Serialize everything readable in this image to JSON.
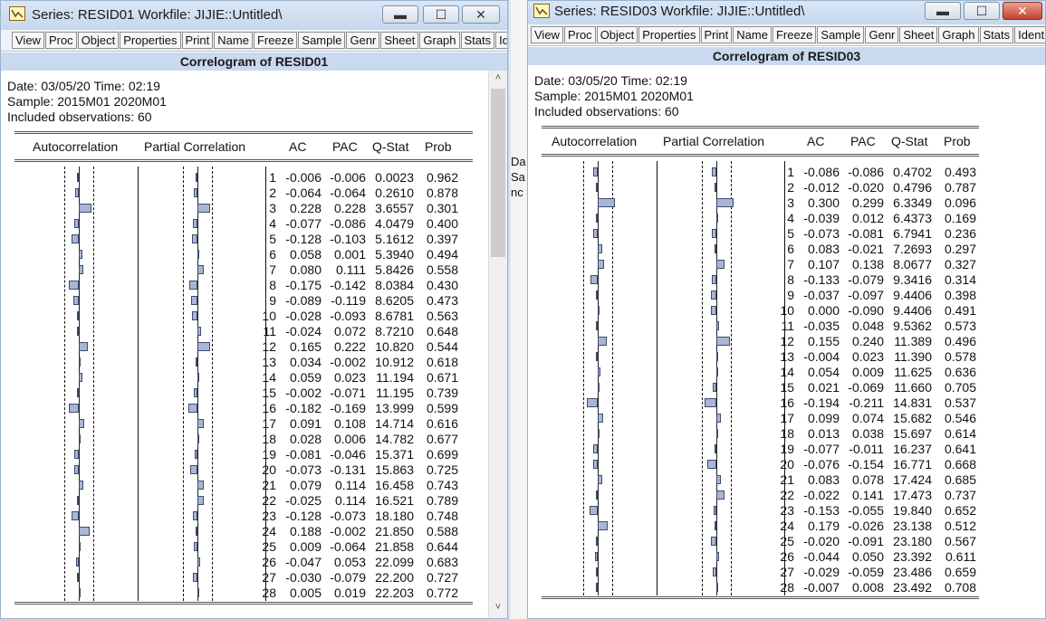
{
  "windows": [
    {
      "id": "w1",
      "title": "Series: RESID01   Workfile: JIJIE::Untitled\\",
      "toolbar": [
        "View",
        "Proc",
        "Object",
        "Properties",
        "|",
        "Print",
        "Name",
        "Freeze",
        "|",
        "Sample",
        "Genr",
        "Sheet",
        "Graph",
        "Stats",
        "Iden"
      ],
      "content_title": "Correlogram of RESID01",
      "date_line": "Date: 03/05/20   Time: 02:19",
      "sample_line": "Sample: 2015M01 2020M01",
      "obs_line": "Included observations: 60",
      "headers": [
        "Autocorrelation",
        "Partial Correlation",
        "AC",
        "PAC",
        "Q-Stat",
        "Prob"
      ],
      "rows": [
        [
          "1",
          "-0.006",
          "-0.006",
          "0.0023",
          "0.962"
        ],
        [
          "2",
          "-0.064",
          "-0.064",
          "0.2610",
          "0.878"
        ],
        [
          "3",
          "0.228",
          "0.228",
          "3.6557",
          "0.301"
        ],
        [
          "4",
          "-0.077",
          "-0.086",
          "4.0479",
          "0.400"
        ],
        [
          "5",
          "-0.128",
          "-0.103",
          "5.1612",
          "0.397"
        ],
        [
          "6",
          "0.058",
          "0.001",
          "5.3940",
          "0.494"
        ],
        [
          "7",
          "0.080",
          "0.111",
          "5.8426",
          "0.558"
        ],
        [
          "8",
          "-0.175",
          "-0.142",
          "8.0384",
          "0.430"
        ],
        [
          "9",
          "-0.089",
          "-0.119",
          "8.6205",
          "0.473"
        ],
        [
          "10",
          "-0.028",
          "-0.093",
          "8.6781",
          "0.563"
        ],
        [
          "11",
          "-0.024",
          "0.072",
          "8.7210",
          "0.648"
        ],
        [
          "12",
          "0.165",
          "0.222",
          "10.820",
          "0.544"
        ],
        [
          "13",
          "0.034",
          "-0.002",
          "10.912",
          "0.618"
        ],
        [
          "14",
          "0.059",
          "0.023",
          "11.194",
          "0.671"
        ],
        [
          "15",
          "-0.002",
          "-0.071",
          "11.195",
          "0.739"
        ],
        [
          "16",
          "-0.182",
          "-0.169",
          "13.999",
          "0.599"
        ],
        [
          "17",
          "0.091",
          "0.108",
          "14.714",
          "0.616"
        ],
        [
          "18",
          "0.028",
          "0.006",
          "14.782",
          "0.677"
        ],
        [
          "19",
          "-0.081",
          "-0.046",
          "15.371",
          "0.699"
        ],
        [
          "20",
          "-0.073",
          "-0.131",
          "15.863",
          "0.725"
        ],
        [
          "21",
          "0.079",
          "0.114",
          "16.458",
          "0.743"
        ],
        [
          "22",
          "-0.025",
          "0.114",
          "16.521",
          "0.789"
        ],
        [
          "23",
          "-0.128",
          "-0.073",
          "18.180",
          "0.748"
        ],
        [
          "24",
          "0.188",
          "-0.002",
          "21.850",
          "0.588"
        ],
        [
          "25",
          "0.009",
          "-0.064",
          "21.858",
          "0.644"
        ],
        [
          "26",
          "-0.047",
          "0.053",
          "22.099",
          "0.683"
        ],
        [
          "27",
          "-0.030",
          "-0.079",
          "22.200",
          "0.727"
        ],
        [
          "28",
          "0.005",
          "0.019",
          "22.203",
          "0.772"
        ]
      ]
    },
    {
      "id": "w2",
      "title": "Series: RESID03   Workfile: JIJIE::Untitled\\",
      "toolbar": [
        "View",
        "Proc",
        "Object",
        "Properties",
        "|",
        "Print",
        "Name",
        "Freeze",
        "|",
        "Sample",
        "Genr",
        "Sheet",
        "Graph",
        "Stats",
        "Ident"
      ],
      "content_title": "Correlogram of RESID03",
      "date_line": "Date: 03/05/20   Time: 02:19",
      "sample_line": "Sample: 2015M01 2020M01",
      "obs_line": "Included observations: 60",
      "headers": [
        "Autocorrelation",
        "Partial Correlation",
        "AC",
        "PAC",
        "Q-Stat",
        "Prob"
      ],
      "rows": [
        [
          "1",
          "-0.086",
          "-0.086",
          "0.4702",
          "0.493"
        ],
        [
          "2",
          "-0.012",
          "-0.020",
          "0.4796",
          "0.787"
        ],
        [
          "3",
          "0.300",
          "0.299",
          "6.3349",
          "0.096"
        ],
        [
          "4",
          "-0.039",
          "0.012",
          "6.4373",
          "0.169"
        ],
        [
          "5",
          "-0.073",
          "-0.081",
          "6.7941",
          "0.236"
        ],
        [
          "6",
          "0.083",
          "-0.021",
          "7.2693",
          "0.297"
        ],
        [
          "7",
          "0.107",
          "0.138",
          "8.0677",
          "0.327"
        ],
        [
          "8",
          "-0.133",
          "-0.079",
          "9.3416",
          "0.314"
        ],
        [
          "9",
          "-0.037",
          "-0.097",
          "9.4406",
          "0.398"
        ],
        [
          "10",
          "0.000",
          "-0.090",
          "9.4406",
          "0.491"
        ],
        [
          "11",
          "-0.035",
          "0.048",
          "9.5362",
          "0.573"
        ],
        [
          "12",
          "0.155",
          "0.240",
          "11.389",
          "0.496"
        ],
        [
          "13",
          "-0.004",
          "0.023",
          "11.390",
          "0.578"
        ],
        [
          "14",
          "0.054",
          "0.009",
          "11.625",
          "0.636"
        ],
        [
          "15",
          "0.021",
          "-0.069",
          "11.660",
          "0.705"
        ],
        [
          "16",
          "-0.194",
          "-0.211",
          "14.831",
          "0.537"
        ],
        [
          "17",
          "0.099",
          "0.074",
          "15.682",
          "0.546"
        ],
        [
          "18",
          "0.013",
          "0.038",
          "15.697",
          "0.614"
        ],
        [
          "19",
          "-0.077",
          "-0.011",
          "16.237",
          "0.641"
        ],
        [
          "20",
          "-0.076",
          "-0.154",
          "16.771",
          "0.668"
        ],
        [
          "21",
          "0.083",
          "0.078",
          "17.424",
          "0.685"
        ],
        [
          "22",
          "-0.022",
          "0.141",
          "17.473",
          "0.737"
        ],
        [
          "23",
          "-0.153",
          "-0.055",
          "19.840",
          "0.652"
        ],
        [
          "24",
          "0.179",
          "-0.026",
          "23.138",
          "0.512"
        ],
        [
          "25",
          "-0.020",
          "-0.091",
          "23.180",
          "0.567"
        ],
        [
          "26",
          "-0.044",
          "0.050",
          "23.392",
          "0.611"
        ],
        [
          "27",
          "-0.029",
          "-0.059",
          "23.486",
          "0.659"
        ],
        [
          "28",
          "-0.007",
          "0.008",
          "23.492",
          "0.708"
        ]
      ]
    }
  ],
  "background_fragments": [
    "Da",
    "Sa",
    "nc"
  ],
  "icons": {
    "window": "eviews-series-icon",
    "minimize": "minimize-icon",
    "maximize": "maximize-icon",
    "close": "close-icon"
  },
  "colors": {
    "bar_fill": "#a9b6d3",
    "bar_border": "#3c4c6e",
    "header_band": "#c9d9ef",
    "titlebar": "#c6d8ee"
  }
}
